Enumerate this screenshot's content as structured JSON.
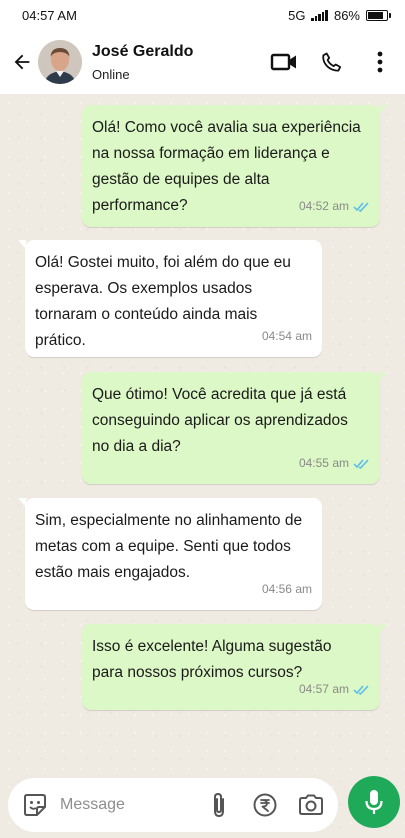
{
  "status_bar": {
    "time": "04:57 AM",
    "network": "5G",
    "battery": "86%",
    "battery_level": 0.86
  },
  "header": {
    "contact_name": "José Geraldo",
    "contact_status": "Online"
  },
  "messages": [
    {
      "direction": "outgoing",
      "text": "Olá! Como você avalia sua experiência na nossa formação em liderança e gestão de equipes de alta performance?",
      "time": "04:52 am",
      "read": true
    },
    {
      "direction": "incoming",
      "text": "Olá! Gostei muito, foi além do que eu esperava. Os exemplos usados tornaram o conteúdo ainda mais prático.",
      "time": "04:54 am",
      "read": false
    },
    {
      "direction": "outgoing",
      "text": "Que ótimo! Você acredita que já está conseguindo aplicar os aprendizados no dia a dia?",
      "time": "04:55 am",
      "read": true
    },
    {
      "direction": "incoming",
      "text": "Sim, especialmente no alinhamento de metas com a equipe. Senti que todos estão mais engajados.",
      "time": "04:56 am",
      "read": false
    },
    {
      "direction": "outgoing",
      "text": "Isso é excelente! Alguma sugestão para nossos próximos cursos?",
      "time": "04:57 am",
      "read": true
    }
  ],
  "composer": {
    "placeholder": "Message"
  },
  "colors": {
    "outgoing_bubble": "#dcf8c6",
    "incoming_bubble": "#ffffff",
    "chat_background": "#efeae2",
    "mic_button": "#1faa59",
    "read_ticks": "#53bdeb"
  },
  "icons": [
    "back-arrow-icon",
    "video-call-icon",
    "phone-icon",
    "more-options-icon",
    "sticker-icon",
    "attachment-icon",
    "rupee-payment-icon",
    "camera-icon",
    "microphone-icon",
    "double-check-icon"
  ]
}
